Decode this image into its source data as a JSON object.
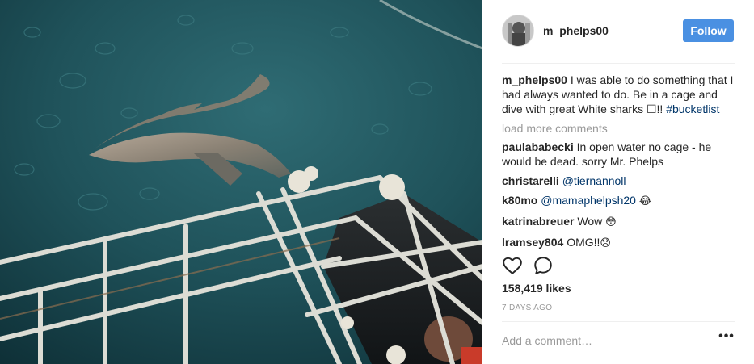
{
  "post": {
    "username": "m_phelps00",
    "follow_label": "Follow",
    "caption_text": "I was able to do something that I had always wanted to do. Be in a cage and dive with great White sharks ☐!! ",
    "caption_hashtag": "#bucketlist",
    "load_more_label": "load more comments",
    "likes": "158,419 likes",
    "date": "7 DAYS AGO",
    "add_comment_placeholder": "Add a comment…",
    "more_options": "•••"
  },
  "comments": [
    {
      "author": "paulababecki",
      "text": "In open water no cage - he would be dead. sorry Mr. Phelps",
      "mention": "",
      "emoji": ""
    },
    {
      "author": "christarelli",
      "text": "",
      "mention": "@tiernannoll",
      "emoji": ""
    },
    {
      "author": "k80mo",
      "text": "",
      "mention": "@mamaphelpsh20",
      "emoji": "😂"
    },
    {
      "author": "katrinabreuer",
      "text": "Wow",
      "mention": "",
      "emoji": "😳"
    },
    {
      "author": "lramsey804",
      "text": "OMG!!",
      "mention": "",
      "emoji": "😞"
    }
  ],
  "icons": {
    "like": "heart-icon",
    "comment": "comment-bubble-icon",
    "more": "more-options-icon"
  },
  "colors": {
    "follow_button": "#4a90e2",
    "link": "#003569",
    "muted": "#999999",
    "water": "#16434a"
  }
}
